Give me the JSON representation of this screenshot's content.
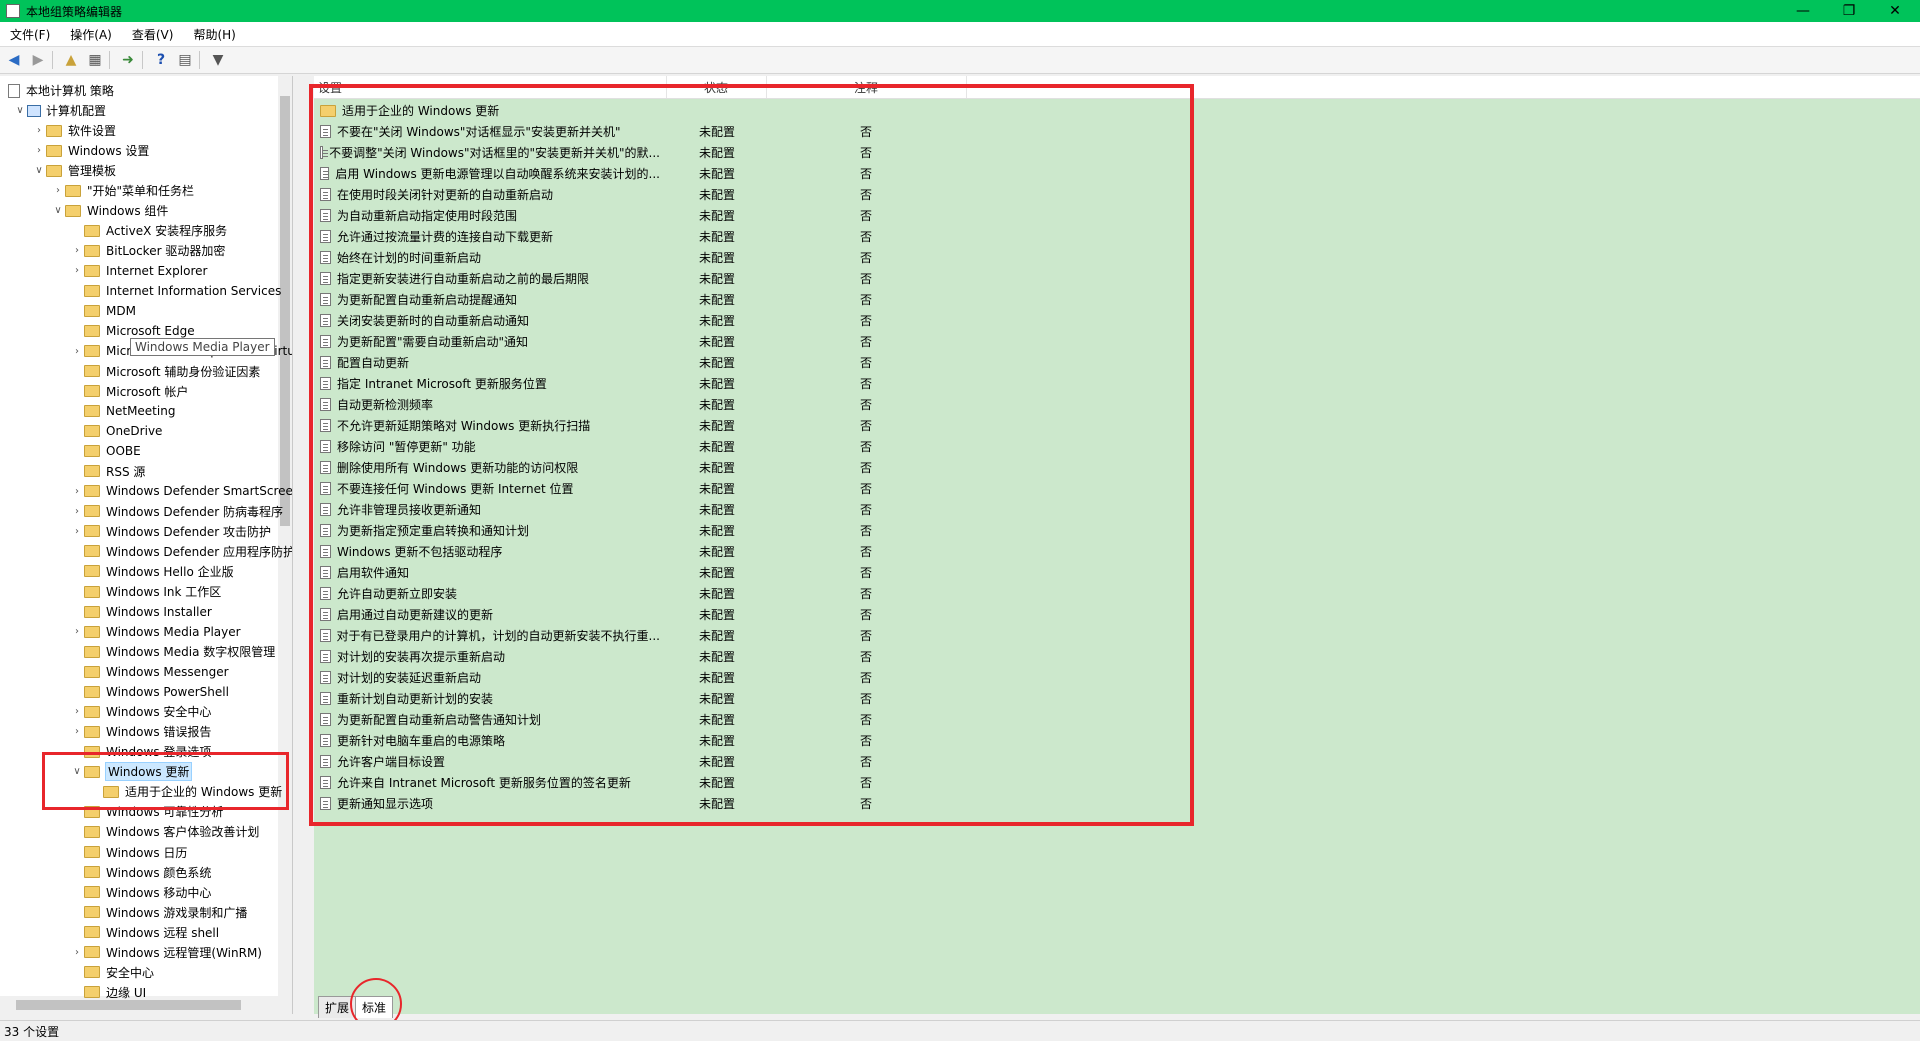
{
  "window": {
    "title": "本地组策略编辑器",
    "controls": [
      "—",
      "❐",
      "✕"
    ]
  },
  "menu": [
    "文件(F)",
    "操作(A)",
    "查看(V)",
    "帮助(H)"
  ],
  "toolbar": {
    "icons": [
      "back-arrow-icon",
      "forward-arrow-icon",
      "up-folder-icon",
      "show-hide-tree-icon",
      "export-list-icon",
      "help-icon",
      "properties-icon",
      "filter-icon"
    ]
  },
  "tree": {
    "items": [
      {
        "label": "本地计算机 策略",
        "indent": 0,
        "twisty": "",
        "icon": "computer-policy-icon"
      },
      {
        "label": "计算机配置",
        "indent": 1,
        "twisty": "∨",
        "icon": "computer-icon"
      },
      {
        "label": "软件设置",
        "indent": 2,
        "twisty": "›",
        "icon": "folder-icon"
      },
      {
        "label": "Windows 设置",
        "indent": 2,
        "twisty": "›",
        "icon": "folder-icon"
      },
      {
        "label": "管理模板",
        "indent": 2,
        "twisty": "∨",
        "icon": "folder-icon"
      },
      {
        "label": "\"开始\"菜单和任务栏",
        "indent": 3,
        "twisty": "›",
        "icon": "folder-icon"
      },
      {
        "label": "Windows 组件",
        "indent": 3,
        "twisty": "∨",
        "icon": "folder-icon"
      },
      {
        "label": "ActiveX 安装程序服务",
        "indent": 4,
        "twisty": "",
        "icon": "folder-icon"
      },
      {
        "label": "BitLocker 驱动器加密",
        "indent": 4,
        "twisty": "›",
        "icon": "folder-icon"
      },
      {
        "label": "Internet Explorer",
        "indent": 4,
        "twisty": "›",
        "icon": "folder-icon"
      },
      {
        "label": "Internet Information Services",
        "indent": 4,
        "twisty": "",
        "icon": "folder-icon"
      },
      {
        "label": "MDM",
        "indent": 4,
        "twisty": "",
        "icon": "folder-icon"
      },
      {
        "label": "Microsoft Edge",
        "indent": 4,
        "twisty": "",
        "icon": "folder-icon"
      },
      {
        "label": "Microsoft User Experience Virtualization",
        "indent": 4,
        "twisty": "›",
        "icon": "folder-icon"
      },
      {
        "label": "Microsoft 辅助身份验证因素",
        "indent": 4,
        "twisty": "",
        "icon": "folder-icon"
      },
      {
        "label": "Microsoft 帐户",
        "indent": 4,
        "twisty": "",
        "icon": "folder-icon"
      },
      {
        "label": "NetMeeting",
        "indent": 4,
        "twisty": "",
        "icon": "folder-icon"
      },
      {
        "label": "OneDrive",
        "indent": 4,
        "twisty": "",
        "icon": "folder-icon"
      },
      {
        "label": "OOBE",
        "indent": 4,
        "twisty": "",
        "icon": "folder-icon"
      },
      {
        "label": "RSS 源",
        "indent": 4,
        "twisty": "",
        "icon": "folder-icon"
      },
      {
        "label": "Windows Defender SmartScreen",
        "indent": 4,
        "twisty": "›",
        "icon": "folder-icon"
      },
      {
        "label": "Windows Defender 防病毒程序",
        "indent": 4,
        "twisty": "›",
        "icon": "folder-icon"
      },
      {
        "label": "Windows Defender 攻击防护",
        "indent": 4,
        "twisty": "›",
        "icon": "folder-icon"
      },
      {
        "label": "Windows Defender 应用程序防护",
        "indent": 4,
        "twisty": "",
        "icon": "folder-icon"
      },
      {
        "label": "Windows Hello 企业版",
        "indent": 4,
        "twisty": "",
        "icon": "folder-icon"
      },
      {
        "label": "Windows Ink 工作区",
        "indent": 4,
        "twisty": "",
        "icon": "folder-icon"
      },
      {
        "label": "Windows Installer",
        "indent": 4,
        "twisty": "",
        "icon": "folder-icon"
      },
      {
        "label": "Windows Media Player",
        "indent": 4,
        "twisty": "›",
        "icon": "folder-icon"
      },
      {
        "label": "Windows Media 数字权限管理",
        "indent": 4,
        "twisty": "",
        "icon": "folder-icon"
      },
      {
        "label": "Windows Messenger",
        "indent": 4,
        "twisty": "",
        "icon": "folder-icon"
      },
      {
        "label": "Windows PowerShell",
        "indent": 4,
        "twisty": "",
        "icon": "folder-icon"
      },
      {
        "label": "Windows 安全中心",
        "indent": 4,
        "twisty": "›",
        "icon": "folder-icon"
      },
      {
        "label": "Windows 错误报告",
        "indent": 4,
        "twisty": "›",
        "icon": "folder-icon"
      },
      {
        "label": "Windows 登录选项",
        "indent": 4,
        "twisty": "",
        "icon": "folder-icon"
      },
      {
        "label": "Windows 更新",
        "indent": 4,
        "twisty": "∨",
        "icon": "folder-icon",
        "selected": true
      },
      {
        "label": "适用于企业的 Windows 更新",
        "indent": 5,
        "twisty": "",
        "icon": "folder-icon"
      },
      {
        "label": "Windows 可靠性分析",
        "indent": 4,
        "twisty": "",
        "icon": "folder-icon"
      },
      {
        "label": "Windows 客户体验改善计划",
        "indent": 4,
        "twisty": "",
        "icon": "folder-icon"
      },
      {
        "label": "Windows 日历",
        "indent": 4,
        "twisty": "",
        "icon": "folder-icon"
      },
      {
        "label": "Windows 颜色系统",
        "indent": 4,
        "twisty": "",
        "icon": "folder-icon"
      },
      {
        "label": "Windows 移动中心",
        "indent": 4,
        "twisty": "",
        "icon": "folder-icon"
      },
      {
        "label": "Windows 游戏录制和广播",
        "indent": 4,
        "twisty": "",
        "icon": "folder-icon"
      },
      {
        "label": "Windows 远程 shell",
        "indent": 4,
        "twisty": "",
        "icon": "folder-icon"
      },
      {
        "label": "Windows 远程管理(WinRM)",
        "indent": 4,
        "twisty": "›",
        "icon": "folder-icon"
      },
      {
        "label": "安全中心",
        "indent": 4,
        "twisty": "",
        "icon": "folder-icon"
      },
      {
        "label": "边缘 UI",
        "indent": 4,
        "twisty": "",
        "icon": "folder-icon"
      }
    ],
    "tooltip": "Windows Media Player"
  },
  "list": {
    "columns": [
      "设置",
      "状态",
      "注释"
    ],
    "subfolder": "适用于企业的 Windows 更新",
    "rows": [
      {
        "setting": "不要在\"关闭 Windows\"对话框显示\"安装更新并关机\"",
        "state": "未配置",
        "comment": "否"
      },
      {
        "setting": "不要调整\"关闭 Windows\"对话框里的\"安装更新并关机\"的默...",
        "state": "未配置",
        "comment": "否"
      },
      {
        "setting": "启用 Windows 更新电源管理以自动唤醒系统来安装计划的...",
        "state": "未配置",
        "comment": "否"
      },
      {
        "setting": "在使用时段关闭针对更新的自动重新启动",
        "state": "未配置",
        "comment": "否"
      },
      {
        "setting": "为自动重新启动指定使用时段范围",
        "state": "未配置",
        "comment": "否"
      },
      {
        "setting": "允许通过按流量计费的连接自动下载更新",
        "state": "未配置",
        "comment": "否"
      },
      {
        "setting": "始终在计划的时间重新启动",
        "state": "未配置",
        "comment": "否"
      },
      {
        "setting": "指定更新安装进行自动重新启动之前的最后期限",
        "state": "未配置",
        "comment": "否"
      },
      {
        "setting": "为更新配置自动重新启动提醒通知",
        "state": "未配置",
        "comment": "否"
      },
      {
        "setting": "关闭安装更新时的自动重新启动通知",
        "state": "未配置",
        "comment": "否"
      },
      {
        "setting": "为更新配置\"需要自动重新启动\"通知",
        "state": "未配置",
        "comment": "否"
      },
      {
        "setting": "配置自动更新",
        "state": "未配置",
        "comment": "否"
      },
      {
        "setting": "指定 Intranet Microsoft 更新服务位置",
        "state": "未配置",
        "comment": "否"
      },
      {
        "setting": "自动更新检测频率",
        "state": "未配置",
        "comment": "否"
      },
      {
        "setting": "不允许更新延期策略对 Windows 更新执行扫描",
        "state": "未配置",
        "comment": "否"
      },
      {
        "setting": "移除访问 \"暂停更新\" 功能",
        "state": "未配置",
        "comment": "否"
      },
      {
        "setting": "删除使用所有 Windows 更新功能的访问权限",
        "state": "未配置",
        "comment": "否"
      },
      {
        "setting": "不要连接任何 Windows 更新 Internet 位置",
        "state": "未配置",
        "comment": "否"
      },
      {
        "setting": "允许非管理员接收更新通知",
        "state": "未配置",
        "comment": "否"
      },
      {
        "setting": "为更新指定预定重启转换和通知计划",
        "state": "未配置",
        "comment": "否"
      },
      {
        "setting": "Windows 更新不包括驱动程序",
        "state": "未配置",
        "comment": "否"
      },
      {
        "setting": "启用软件通知",
        "state": "未配置",
        "comment": "否"
      },
      {
        "setting": "允许自动更新立即安装",
        "state": "未配置",
        "comment": "否"
      },
      {
        "setting": "启用通过自动更新建议的更新",
        "state": "未配置",
        "comment": "否"
      },
      {
        "setting": "对于有已登录用户的计算机，计划的自动更新安装不执行重...",
        "state": "未配置",
        "comment": "否"
      },
      {
        "setting": "对计划的安装再次提示重新启动",
        "state": "未配置",
        "comment": "否"
      },
      {
        "setting": "对计划的安装延迟重新启动",
        "state": "未配置",
        "comment": "否"
      },
      {
        "setting": "重新计划自动更新计划的安装",
        "state": "未配置",
        "comment": "否"
      },
      {
        "setting": "为更新配置自动重新启动警告通知计划",
        "state": "未配置",
        "comment": "否"
      },
      {
        "setting": "更新针对电脑车重启的电源策略",
        "state": "未配置",
        "comment": "否"
      },
      {
        "setting": "允许客户端目标设置",
        "state": "未配置",
        "comment": "否"
      },
      {
        "setting": "允许来自 Intranet Microsoft 更新服务位置的签名更新",
        "state": "未配置",
        "comment": "否"
      },
      {
        "setting": "更新通知显示选项",
        "state": "未配置",
        "comment": "否"
      }
    ]
  },
  "tabs": [
    "扩展",
    "标准"
  ],
  "status": "33 个设置",
  "colors": {
    "titlebar": "#00c35a",
    "list_background": "#cce8cc",
    "highlight": "#e8262b"
  }
}
